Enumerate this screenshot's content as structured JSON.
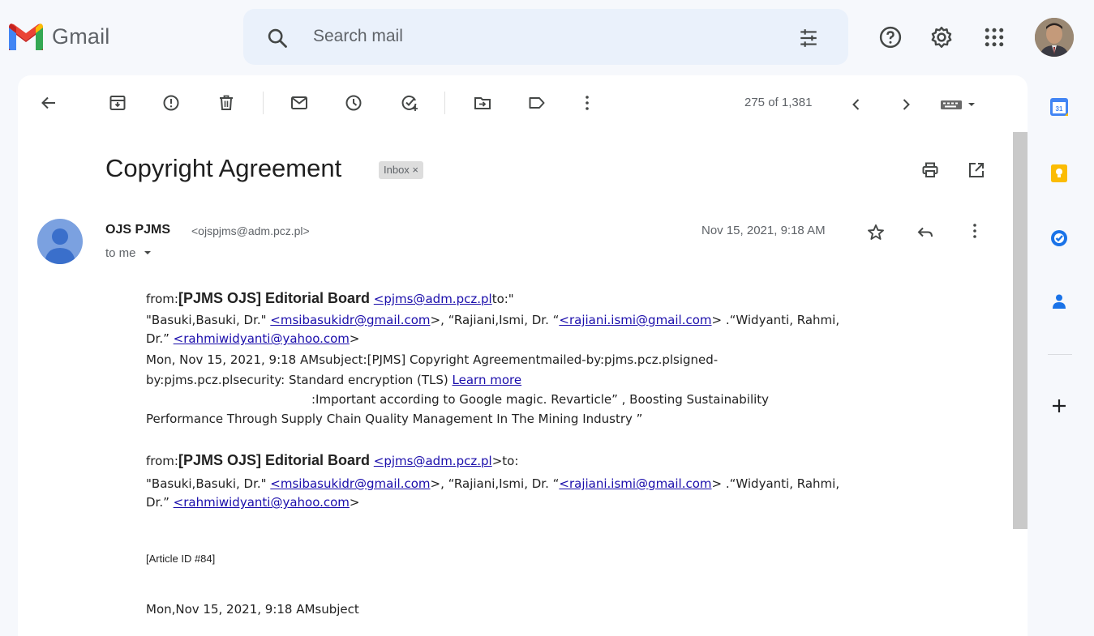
{
  "app": {
    "name": "Gmail"
  },
  "search": {
    "placeholder": "Search mail"
  },
  "toolbar": {
    "page_count": "275 of 1,381"
  },
  "email": {
    "subject": "Copyright Agreement",
    "label": "Inbox ×",
    "sender_name": "OJS PJMS",
    "sender_email": "<ojspjms@adm.pcz.pl>",
    "recipient": "to me",
    "date": "Nov 15, 2021, 9:18 AM"
  },
  "body": {
    "block1": {
      "from_prefix": "from:",
      "from_name": "[PJMS OJS] Editorial Board",
      "from_email": "<pjms@adm.pcz.pl",
      "from_suffix": "to:\"",
      "line2_a": "\"Basuki,Basuki, Dr.\" ",
      "line2_link1": "<msibasukidr@gmail.com",
      "line2_b": ">, “Rajiani,Ismi, Dr. “",
      "line2_link2": "<rajiani.ismi@gmail.com",
      "line2_c": "> .“Widyanti, Rahmi,",
      "line3_a": "Dr.” ",
      "line3_link": "<rahmiwidyanti@yahoo.com",
      "line3_b": ">",
      "line4": "Mon, Nov 15, 2021, 9:18 AMsubject:[PJMS] Copyright Agreementmailed-by:pjms.pcz.plsigned-",
      "line5_a": "by:pjms.pcz.plsecurity: Standard encryption (TLS) ",
      "line5_link": "Learn more",
      "line6": ":Important according to Google magic. Revarticle” , Boosting Sustainability",
      "line7": "Performance Through Supply Chain Quality Management In The Mining Industry ”"
    },
    "block2": {
      "from_prefix": "from:",
      "from_name": "[PJMS OJS] Editorial Board",
      "from_email": "<pjms@adm.pcz.pl",
      "from_suffix": ">to:",
      "line2_a": "\"Basuki,Basuki, Dr.\" ",
      "line2_link1": "<msibasukidr@gmail.com",
      "line2_b": ">, “Rajiani,Ismi, Dr. “",
      "line2_link2": "<rajiani.ismi@gmail.com",
      "line2_c": "> .“Widyanti, Rahmi,",
      "line3_a": "Dr.” ",
      "line3_link": "<rahmiwidyanti@yahoo.com",
      "line3_b": ">"
    },
    "article_id": "[Article ID #84]",
    "last_line": "Mon,Nov 15, 2021, 9:18 AMsubject"
  },
  "colors": {
    "background": "#f6f8fc",
    "search_bg": "#eaf1fb",
    "link": "#1a0dab",
    "gmail_red": "#ea4335",
    "gmail_blue": "#4285f4",
    "gmail_green": "#34a853",
    "gmail_yellow": "#fbbc04"
  }
}
